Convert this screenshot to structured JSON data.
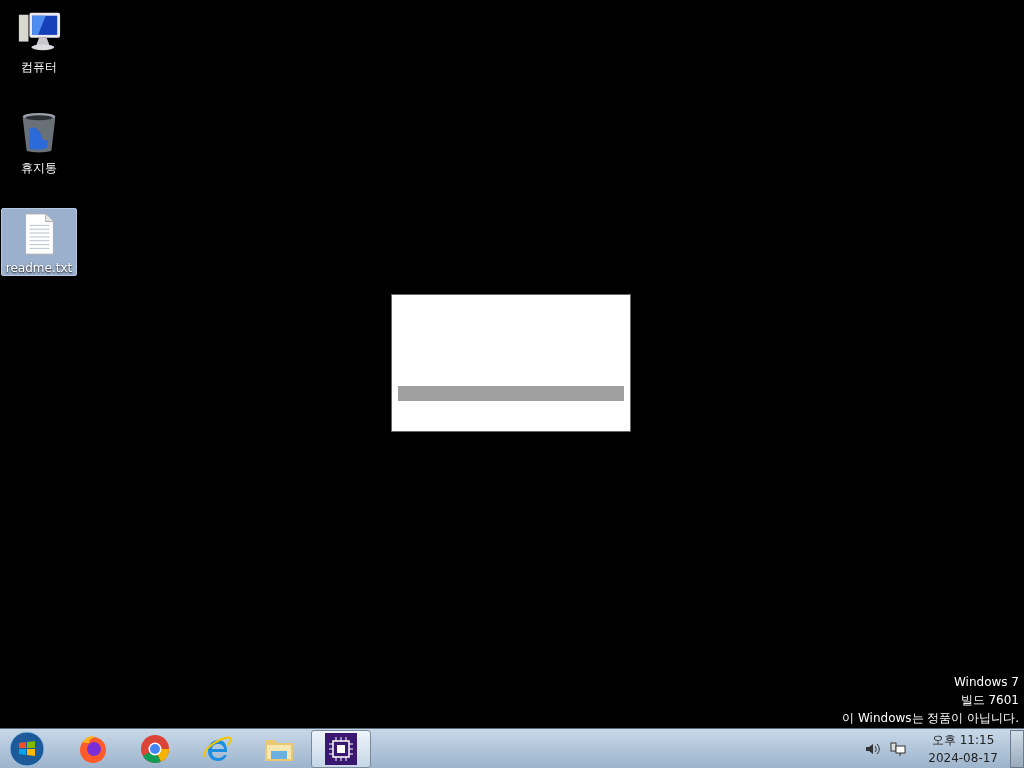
{
  "desktop_icons": [
    {
      "kind": "computer",
      "label": "컴퓨터",
      "selected": false
    },
    {
      "kind": "trash",
      "label": "휴지통",
      "selected": false
    },
    {
      "kind": "textfile",
      "label": "readme.txt",
      "selected": true
    }
  ],
  "splash_window": {
    "visible": true
  },
  "desktop_notice": [
    "Windows 7",
    "빌드 7601",
    "이 Windows는 정품이 아닙니다."
  ],
  "taskbar": {
    "apps": [
      {
        "kind": "firefox",
        "selected": false
      },
      {
        "kind": "chrome",
        "selected": false
      },
      {
        "kind": "ie",
        "selected": false
      },
      {
        "kind": "explorer",
        "selected": false
      },
      {
        "kind": "chip",
        "selected": true
      }
    ],
    "clock": {
      "time": "오후 11:15",
      "date": "2024-08-17"
    }
  }
}
